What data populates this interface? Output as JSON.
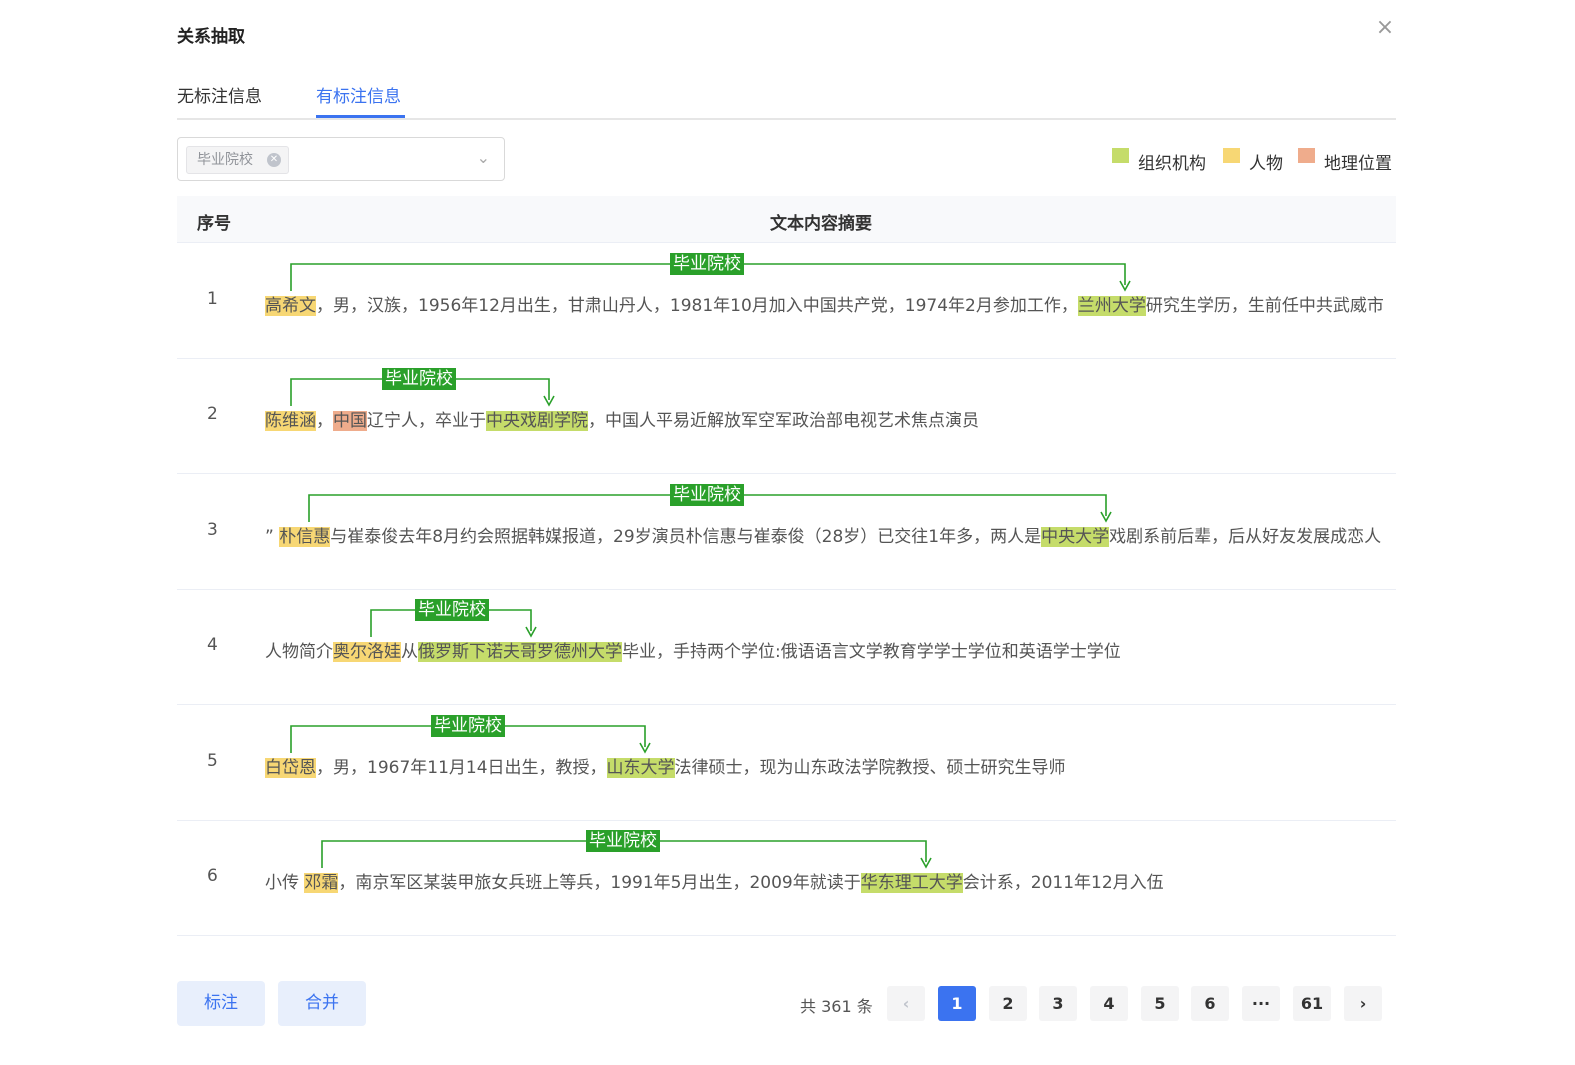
{
  "dialog": {
    "title": "关系抽取",
    "close_icon": "close-icon"
  },
  "tabs": [
    {
      "label": "无标注信息"
    },
    {
      "label": "有标注信息",
      "active": true
    }
  ],
  "filter": {
    "selected_tag": "毕业院校"
  },
  "legend": [
    {
      "label": "组织机构",
      "color": "#c5dc6a"
    },
    {
      "label": "人物",
      "color": "#f7d774"
    },
    {
      "label": "地理位置",
      "color": "#efac8c"
    }
  ],
  "table": {
    "columns": [
      "序号",
      "文本内容摘要"
    ],
    "rows": [
      {
        "index": "1",
        "relation": "毕业院校",
        "segments": [
          {
            "t": "高希文",
            "c": "per"
          },
          {
            "t": "，男，汉族，1956年12月出生，甘肃山丹人，1981年10月加入中国共产党，1974年2月参加工作，"
          },
          {
            "t": "兰州大学",
            "c": "org"
          },
          {
            "t": "研究生学历，生前任中共武威市委常委、市人民政府常务副市长"
          }
        ]
      },
      {
        "index": "2",
        "relation": "毕业院校",
        "segments": [
          {
            "t": "陈维涵",
            "c": "per"
          },
          {
            "t": "，"
          },
          {
            "t": "中国",
            "c": "loc"
          },
          {
            "t": "辽宁人，卒业于"
          },
          {
            "t": "中央戏剧学院",
            "c": "org"
          },
          {
            "t": "，中国人平易近解放军空军政治部电视艺术焦点演员"
          }
        ]
      },
      {
        "index": "3",
        "relation": "毕业院校",
        "segments": [
          {
            "t": "” "
          },
          {
            "t": "朴信惠",
            "c": "per"
          },
          {
            "t": "与崔泰俊去年8月约会照据韩媒报道，29岁演员朴信惠与崔泰俊（28岁）已交往1年多，两人是"
          },
          {
            "t": "中央大学",
            "c": "org"
          },
          {
            "t": "戏剧系前后辈，后从好友发展成恋人"
          }
        ]
      },
      {
        "index": "4",
        "relation": "毕业院校",
        "segments": [
          {
            "t": "人物简介"
          },
          {
            "t": "奥尔洛娃",
            "c": "per"
          },
          {
            "t": "从"
          },
          {
            "t": "俄罗斯下诺夫哥罗德州大学",
            "c": "org"
          },
          {
            "t": "毕业，手持两个学位:俄语语言文学教育学学士学位和英语学士学位"
          }
        ]
      },
      {
        "index": "5",
        "relation": "毕业院校",
        "segments": [
          {
            "t": "白岱恩",
            "c": "per"
          },
          {
            "t": "，男，1967年11月14日出生，教授，"
          },
          {
            "t": "山东大学",
            "c": "org"
          },
          {
            "t": "法律硕士，现为山东政法学院教授、硕士研究生导师"
          }
        ]
      },
      {
        "index": "6",
        "relation": "毕业院校",
        "segments": [
          {
            "t": "小传 "
          },
          {
            "t": "邓霜",
            "c": "per"
          },
          {
            "t": "，南京军区某装甲旅女兵班上等兵，1991年5月出生，2009年就读于"
          },
          {
            "t": "华东理工大学",
            "c": "org"
          },
          {
            "t": "会计系，2011年12月入伍"
          }
        ]
      }
    ]
  },
  "footer": {
    "annotate_label": "标注",
    "merge_label": "合并",
    "total_text": "共 361 条",
    "pages": [
      "1",
      "2",
      "3",
      "4",
      "5",
      "6",
      "···",
      "61"
    ],
    "current_page": "1",
    "prev_icon": "chevron-left-icon",
    "next_icon": "chevron-right-icon"
  }
}
